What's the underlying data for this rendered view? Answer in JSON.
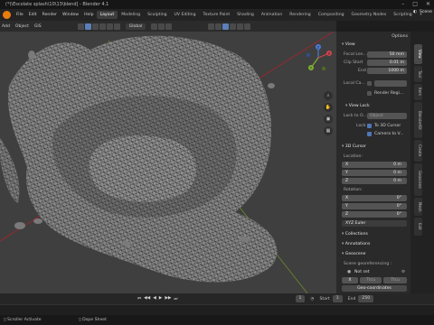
{
  "window": {
    "title": "(*)\\Escolate splash\\10\\13\\blend] - Blender 4.1"
  },
  "topbar": {
    "menus": [
      "File",
      "Edit",
      "Render",
      "Window",
      "Help"
    ],
    "workspaces": [
      "Layout",
      "Modeling",
      "Sculpting",
      "UV Editing",
      "Texture Paint",
      "Shading",
      "Animation",
      "Rendering",
      "Compositing",
      "Geometry Nodes",
      "Scripting"
    ],
    "add_workspace": "+",
    "scene_label": "Scene"
  },
  "viewport_header": {
    "menus": [
      "Add",
      "Object",
      "GIS"
    ],
    "transform_orientation": "Global",
    "options_label": "Options"
  },
  "npanel": {
    "view": {
      "title": "View",
      "focal_label": "Focal Len...",
      "focal_value": "50 mm",
      "clip_label": "Clip Start",
      "clip_start": "0.01 m",
      "end_label": "End",
      "clip_end": "1000 m",
      "local_camera_label": "Local Ca...",
      "render_region_label": "Render Regi..."
    },
    "view_lock": {
      "title": "View Lock",
      "lock_to_label": "Lock to O...",
      "lock_to_value": "Object",
      "lock_label": "Lock",
      "to_3d_cursor": "To 3D Cursor",
      "camera_to_view": "Camera to V..."
    },
    "cursor": {
      "title": "3D Cursor",
      "location_label": "Location:",
      "x": "0 m",
      "y": "0 m",
      "z": "0 m",
      "rotation_label": "Rotation:",
      "rx": "0°",
      "ry": "0°",
      "rz": "0°",
      "mode": "XYZ Euler"
    },
    "collections": {
      "title": "Collections"
    },
    "annotations": {
      "title": "Annotations"
    },
    "geoscene": {
      "title": "Geoscene",
      "georef_label": "Scene georeferencing :",
      "not_set": "Not set",
      "x_field": "X",
      "y_field": "Y",
      "x_value": "Ttcu",
      "y_value": "Ttcu",
      "geo_button": "Geo-coordinates"
    }
  },
  "sidetabs": [
    "View",
    "Tool",
    "Item",
    "BlenderKit",
    "Create",
    "Geoscene",
    "Mesh",
    "Edit"
  ],
  "axis_labels": [
    "X",
    "Y",
    "Z"
  ],
  "timeline": {
    "start_label": "Start",
    "start_value": "1",
    "end_label": "End",
    "end_value": "250",
    "current_frame": "1"
  },
  "status": {
    "left": "Scroller Activate",
    "middle": "Dope Sheet"
  },
  "colors": {
    "accent": "#e87d0d",
    "highlight": "#4e77b8"
  }
}
